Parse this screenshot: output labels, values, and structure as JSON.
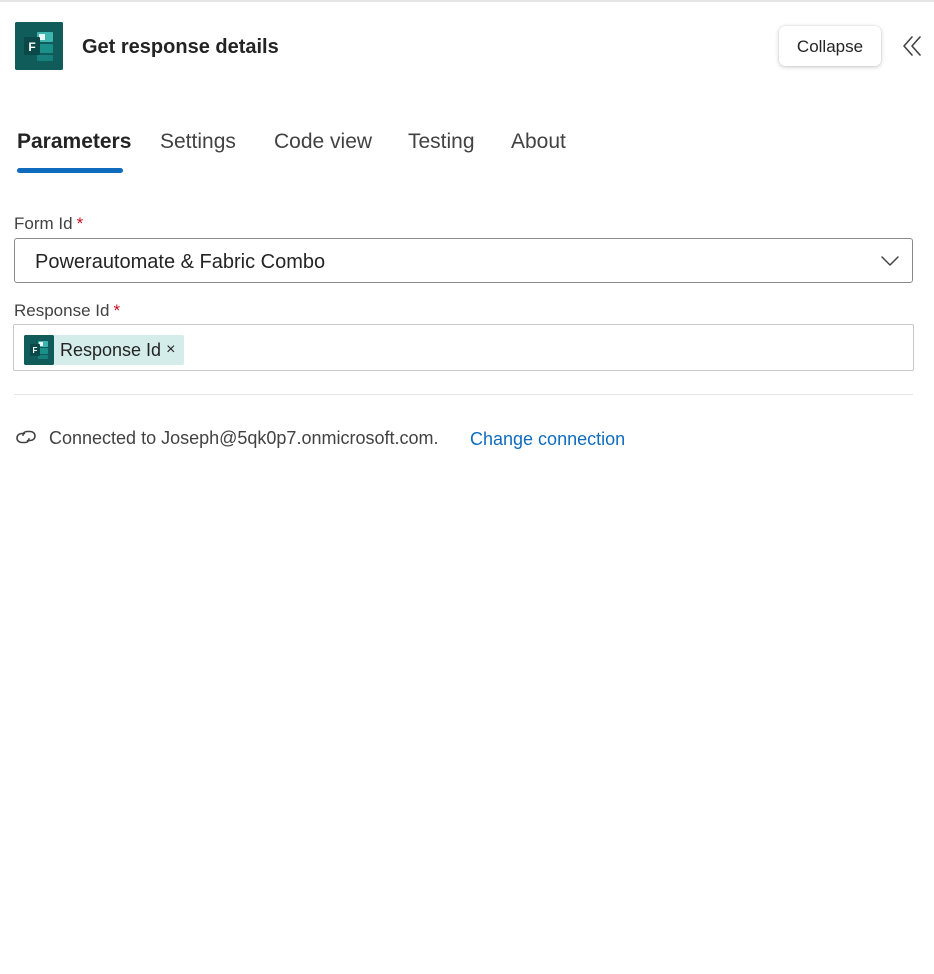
{
  "header": {
    "icon": "microsoft-forms-icon",
    "title": "Get response details",
    "collapse_label": "Collapse",
    "collapse_panel_icon": "double-chevron-left-icon"
  },
  "tabs": [
    {
      "label": "Parameters",
      "active": true
    },
    {
      "label": "Settings",
      "active": false
    },
    {
      "label": "Code view",
      "active": false
    },
    {
      "label": "Testing",
      "active": false
    },
    {
      "label": "About",
      "active": false
    }
  ],
  "fields": {
    "form_id": {
      "label": "Form Id",
      "required_mark": "*",
      "value": "Powerautomate & Fabric Combo",
      "dropdown_icon": "chevron-down-icon"
    },
    "response_id": {
      "label": "Response Id",
      "required_mark": "*",
      "token": {
        "label": "Response Id",
        "remove_symbol": "×",
        "icon": "microsoft-forms-icon"
      }
    }
  },
  "connection": {
    "icon": "link-icon",
    "text": "Connected to Joseph@5qk0p7.onmicrosoft.com.",
    "change_label": "Change connection"
  },
  "colors": {
    "brand_teal": "#0f5c5a",
    "token_bg": "#d4ecea",
    "accent_blue": "#0f6cbd",
    "required_red": "#c50f1f"
  }
}
